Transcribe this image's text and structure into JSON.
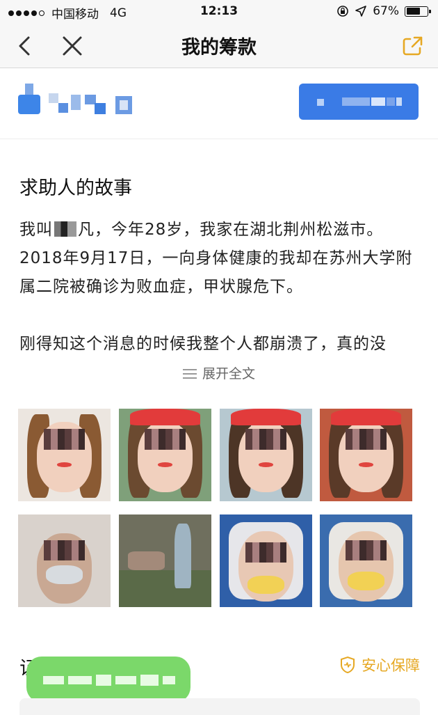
{
  "status_bar": {
    "carrier": "中国移动",
    "network": "4G",
    "time": "12:13",
    "battery": "67%",
    "battery_level": 0.67
  },
  "nav": {
    "title": "我的筹款",
    "back_icon": "chevron-left-icon",
    "close_icon": "close-icon",
    "share_icon": "share-icon"
  },
  "story": {
    "heading": "求助人的故事",
    "para1_a": "我叫",
    "para1_b": "凡，今年28岁，我家在湖北荆州松滋市。2018年9月17日，一向身体健康的我却在苏州大学附属二院被确诊为败血症，甲状腺危下。",
    "para2": "刚得知这个消息的时候我整个人都崩溃了，真的没",
    "expand_label": "展开全文"
  },
  "section2": {
    "heading": "证",
    "safety_label": "安心保障",
    "safety_icon": "shield-heart-icon"
  },
  "colors": {
    "accent_blue": "#3a7be6",
    "safety_gold": "#e6a823",
    "bubble_green": "#7bd86a"
  }
}
